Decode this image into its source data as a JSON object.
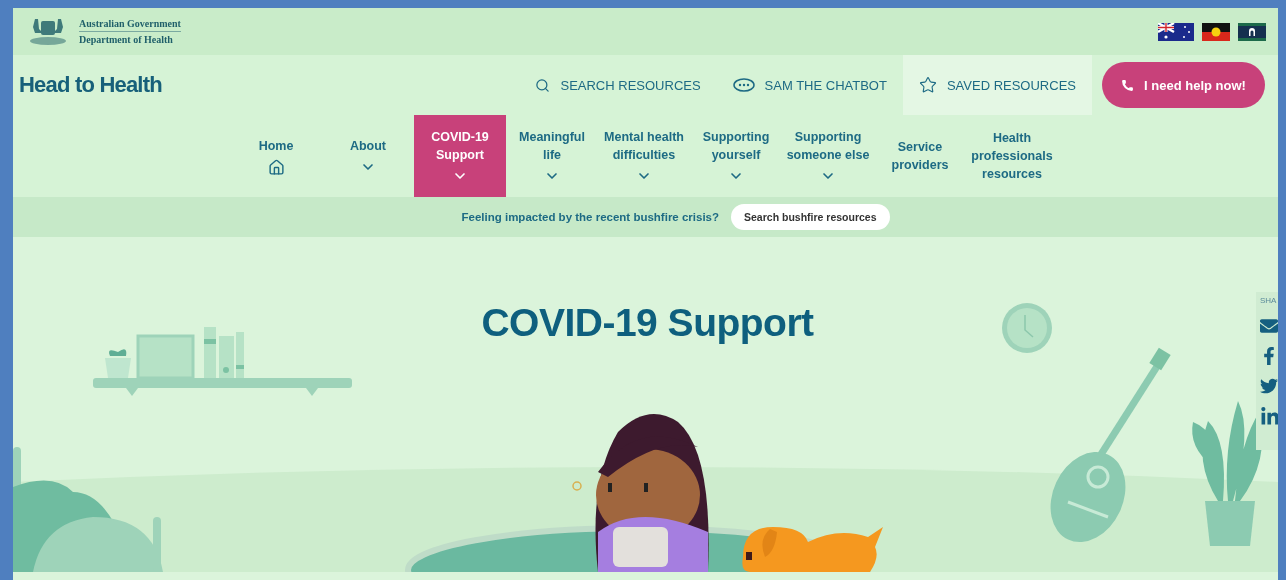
{
  "government": {
    "line_1": "Australian Government",
    "line_2": "Department of Health"
  },
  "header": {
    "logo": "Head to Health",
    "links": [
      {
        "kind": "search",
        "label": "SEARCH RESOURCES",
        "selected": false
      },
      {
        "kind": "chat",
        "label": "SAM THE CHATBOT",
        "selected": false
      },
      {
        "kind": "star",
        "label": "SAVED RESOURCES",
        "selected": true
      }
    ],
    "help_button": "I need help now!"
  },
  "nav": [
    {
      "kind": "home",
      "label": "Home",
      "selected": false
    },
    {
      "kind": "menu",
      "label": "About",
      "selected": false
    },
    {
      "kind": "menu",
      "label": "COVID-19\nSupport",
      "selected": true
    },
    {
      "kind": "menu",
      "label": "Meaningful\nlife",
      "selected": false
    },
    {
      "kind": "menu",
      "label": "Mental health\ndifficulties",
      "selected": false
    },
    {
      "kind": "menu",
      "label": "Supporting\nyourself",
      "selected": false
    },
    {
      "kind": "menu",
      "label": "Supporting\nsomeone else",
      "selected": false
    },
    {
      "kind": "plain",
      "label": "Service\nproviders",
      "selected": false
    },
    {
      "kind": "plain",
      "label": "Health\nprofessionals\nresources",
      "selected": false
    }
  ],
  "bushfire": {
    "text": "Feeling impacted by the recent bushfire crisis?",
    "button": "Search bushfire resources"
  },
  "hero": {
    "title": "COVID-19 Support"
  },
  "share": {
    "label": "SHA"
  }
}
